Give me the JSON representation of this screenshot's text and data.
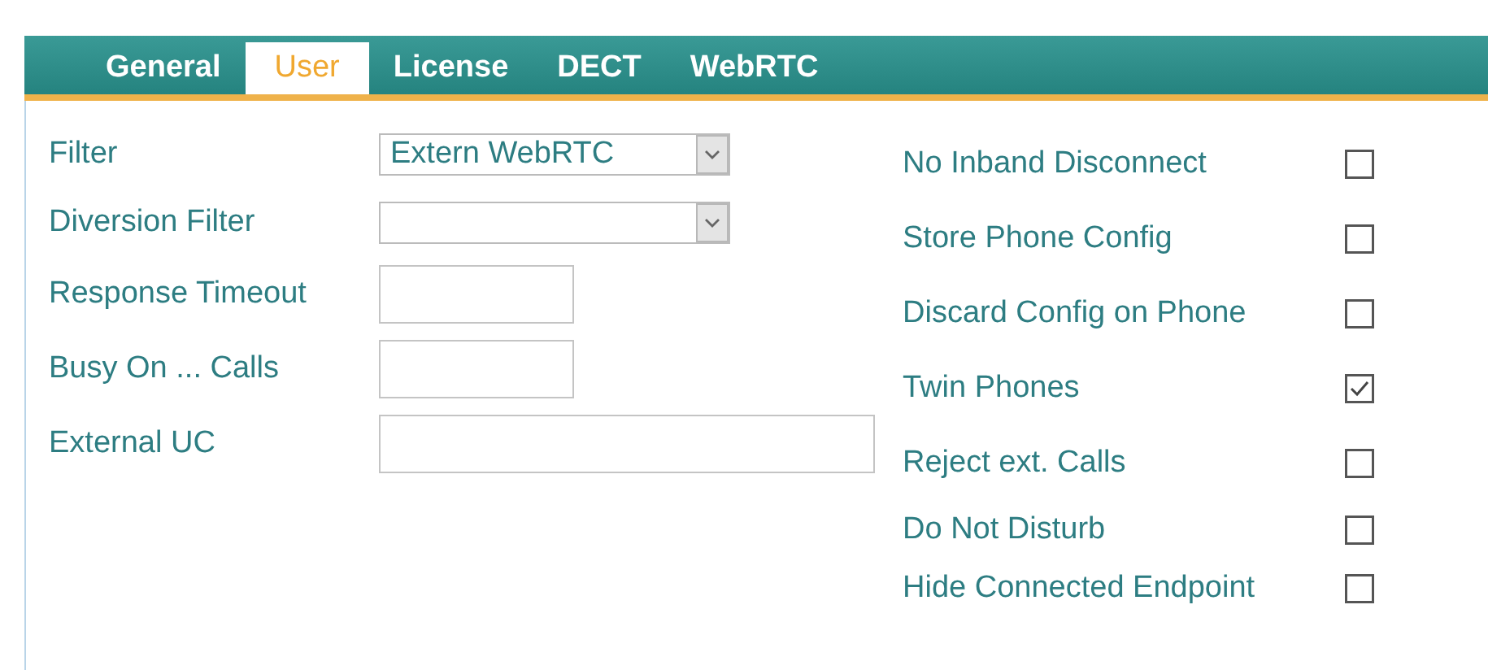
{
  "tabs": [
    {
      "label": "General",
      "selected": false
    },
    {
      "label": "User",
      "selected": true
    },
    {
      "label": "License",
      "selected": false
    },
    {
      "label": "DECT",
      "selected": false
    },
    {
      "label": "WebRTC",
      "selected": false
    }
  ],
  "fields": [
    {
      "label": "Filter",
      "kind": "select",
      "value": "Extern WebRTC"
    },
    {
      "label": "Diversion Filter",
      "kind": "select"
    },
    {
      "label": "Response Timeout",
      "kind": "short"
    },
    {
      "label": "Busy On ... Calls",
      "kind": "short"
    },
    {
      "label": "External UC",
      "kind": "long"
    }
  ],
  "options": [
    {
      "label": "No Inband Disconnect",
      "checked": false
    },
    {
      "label": "Store Phone Config",
      "checked": false
    },
    {
      "label": "Discard Config on Phone",
      "checked": false
    },
    {
      "label": "Twin Phones",
      "checked": true
    },
    {
      "label": "Reject ext. Calls",
      "checked": false
    },
    {
      "label": "Do Not Disturb",
      "checked": false
    },
    {
      "label": "Hide Connected Endpoint",
      "checked": false
    }
  ]
}
